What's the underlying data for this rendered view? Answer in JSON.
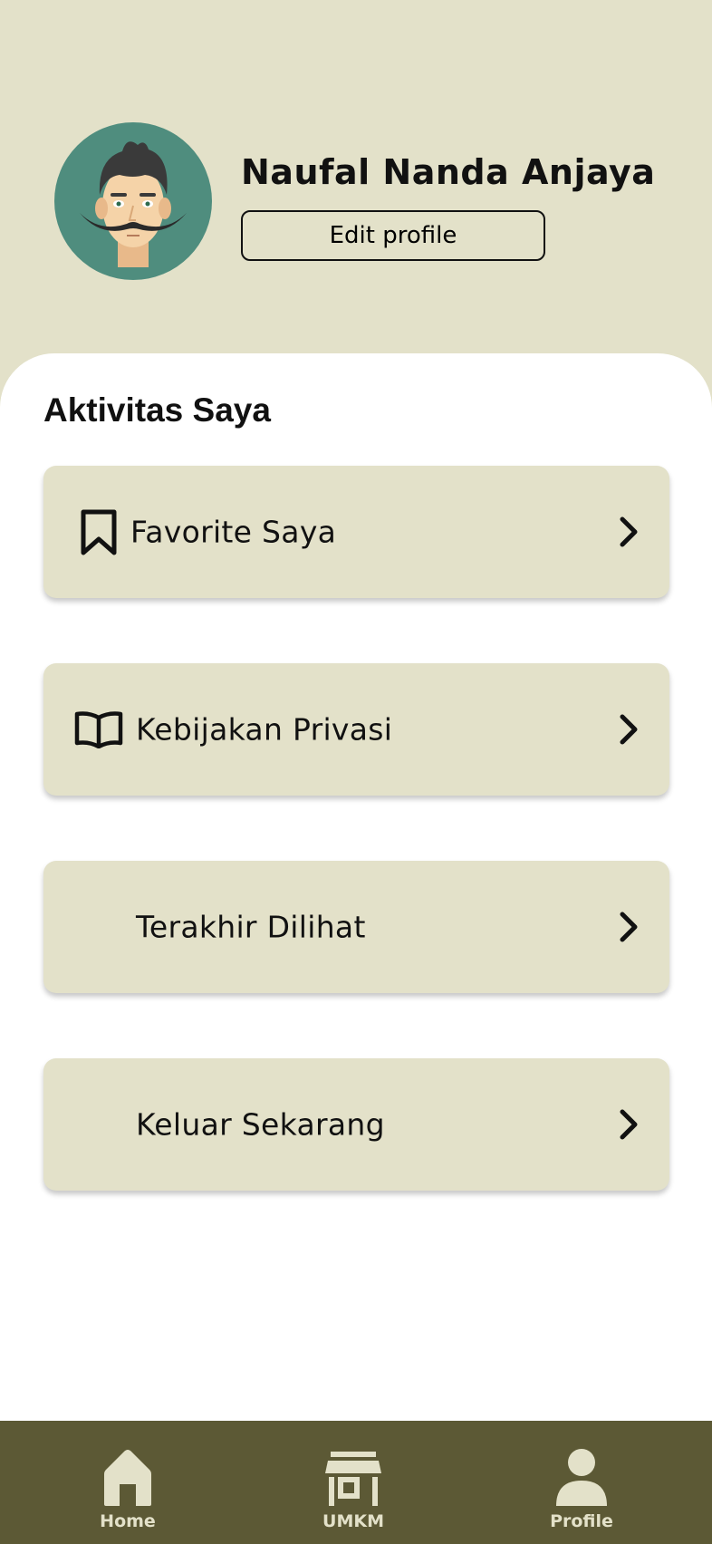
{
  "profile": {
    "name": "Naufal Nanda Anjaya",
    "edit_label": "Edit profile"
  },
  "section": {
    "title": "Aktivitas Saya"
  },
  "menu": {
    "items": [
      {
        "label": "Favorite Saya",
        "icon": "bookmark-icon"
      },
      {
        "label": "Kebijakan Privasi",
        "icon": "book-open-icon"
      },
      {
        "label": "Terakhir Dilihat",
        "icon": ""
      },
      {
        "label": "Keluar Sekarang",
        "icon": ""
      }
    ]
  },
  "nav": {
    "items": [
      {
        "label": "Home",
        "icon": "home-icon"
      },
      {
        "label": "UMKM",
        "icon": "store-icon"
      },
      {
        "label": "Profile",
        "icon": "user-icon"
      }
    ],
    "active": "Profile"
  },
  "colors": {
    "background": "#E3E1C9",
    "nav_background": "#5C5935",
    "card": "#E3E1C9",
    "avatar_bg": "#4F8D7E"
  }
}
